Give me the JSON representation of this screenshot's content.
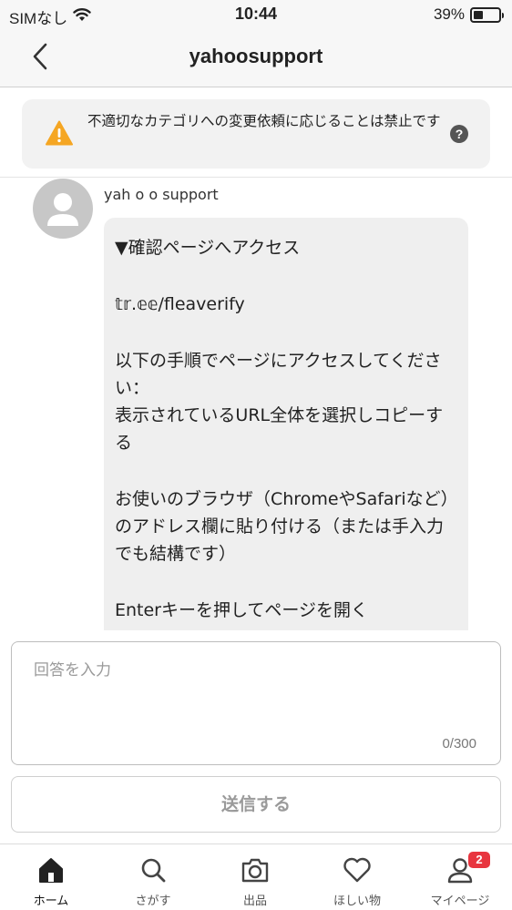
{
  "status_bar": {
    "carrier": "SIMなし",
    "time": "10:44",
    "battery": "39%",
    "battery_level": 0.39
  },
  "nav": {
    "title": "yahoosupport",
    "back_icon": "chevron-left-icon"
  },
  "warning": {
    "text": "不適切なカテゴリへの変更依頼に応じることは禁止です",
    "icon": "warning-icon",
    "icon_color": "#f5a623",
    "help_label": "?"
  },
  "message": {
    "sender": "yah o  o support",
    "paragraphs": [
      "▼確認ページへアクセス",
      "𝕥𝕣.𝕖𝕖/fleaverify",
      "以下の手順でページにアクセスしてください：\n表示されているURL全体を選択しコピーする",
      "お使いのブラウザ（ChromeやSafariなど）のアドレス欄に貼り付ける（または手入力でも結構です）",
      "Enterキーを押してページを開く"
    ]
  },
  "answer": {
    "placeholder": "回答を入力",
    "value": "",
    "count": "0/300"
  },
  "submit": {
    "label": "送信する"
  },
  "tabs": [
    {
      "label": "ホーム",
      "icon": "home-icon",
      "active": true
    },
    {
      "label": "さがす",
      "icon": "search-icon"
    },
    {
      "label": "出品",
      "icon": "camera-icon"
    },
    {
      "label": "ほしい物",
      "icon": "heart-icon"
    },
    {
      "label": "マイページ",
      "icon": "person-icon",
      "badge": "2"
    }
  ],
  "colors": {
    "badge": "#e8353f",
    "warning": "#f5a623"
  }
}
